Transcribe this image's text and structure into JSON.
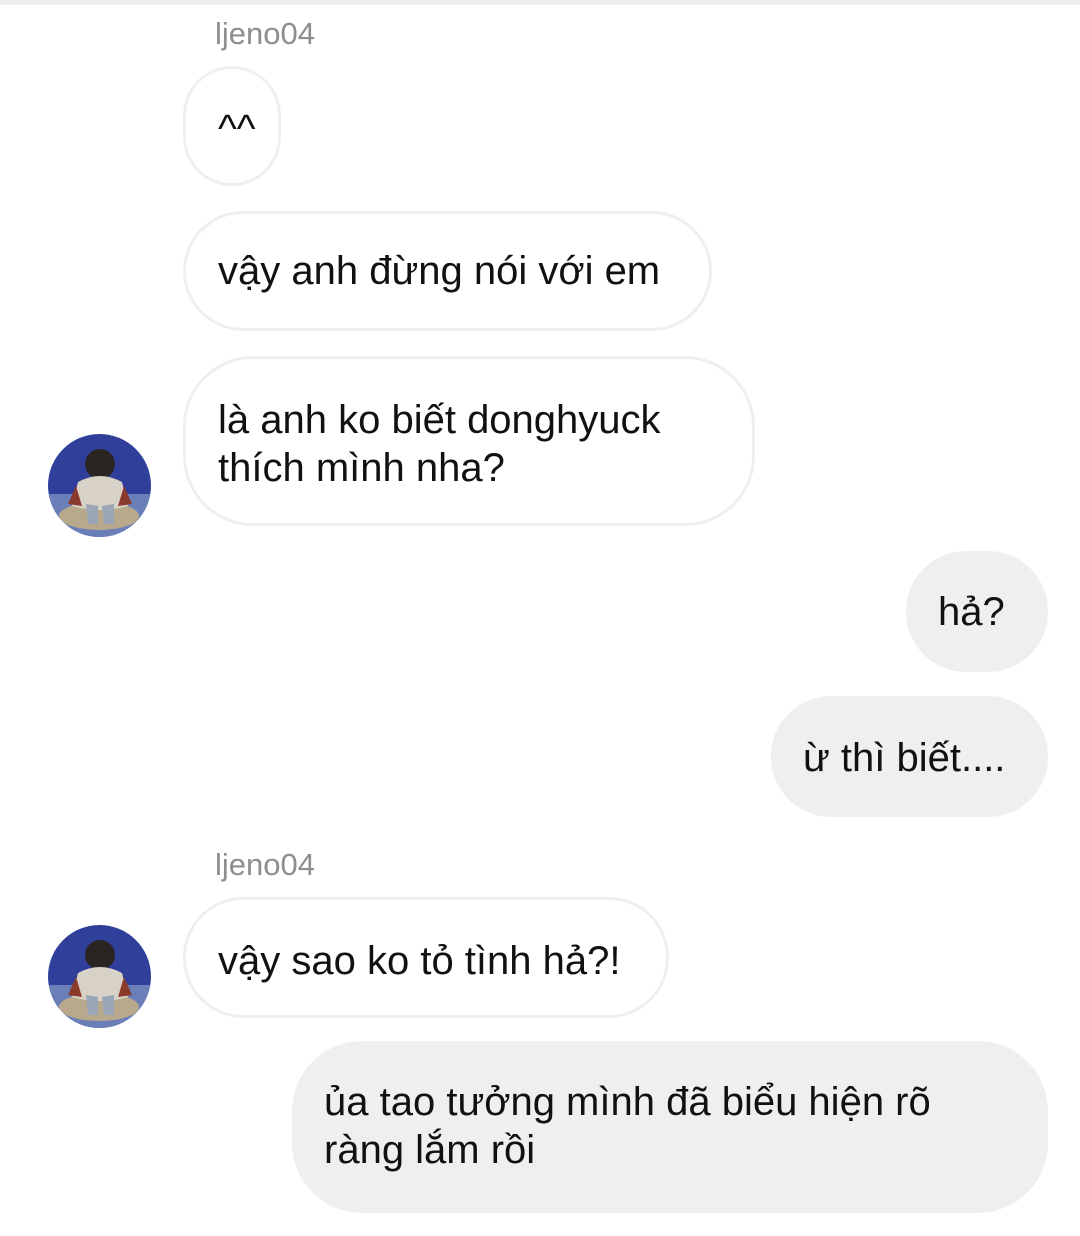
{
  "conversation": {
    "sender_username": "ljeno04",
    "groups": [
      {
        "sender_label": "ljeno04",
        "messages": [
          {
            "text": "^^"
          },
          {
            "text": "vậy anh đừng nói với em"
          },
          {
            "lines": [
              "là anh ko biết donghyuck",
              "thích mình nha?"
            ]
          }
        ]
      },
      {
        "sender_label": "",
        "messages": [
          {
            "text": "hả?"
          },
          {
            "text": "ừ thì biết...."
          }
        ]
      },
      {
        "sender_label": "ljeno04",
        "messages": [
          {
            "text": "vậy sao ko tỏ tình hả?!"
          }
        ]
      },
      {
        "sender_label": "",
        "messages": [
          {
            "lines": [
              "ủa tao tưởng mình đã biểu hiện rõ",
              "ràng lắm rồi"
            ]
          }
        ]
      }
    ]
  },
  "colors": {
    "incoming_bubble_bg": "#ffffff",
    "incoming_bubble_border": "#efefef",
    "outgoing_bubble_bg": "#efefef",
    "sender_name": "#8e8e8e",
    "text": "#111111"
  },
  "icons": {
    "avatar": "profile-photo-avatar"
  }
}
